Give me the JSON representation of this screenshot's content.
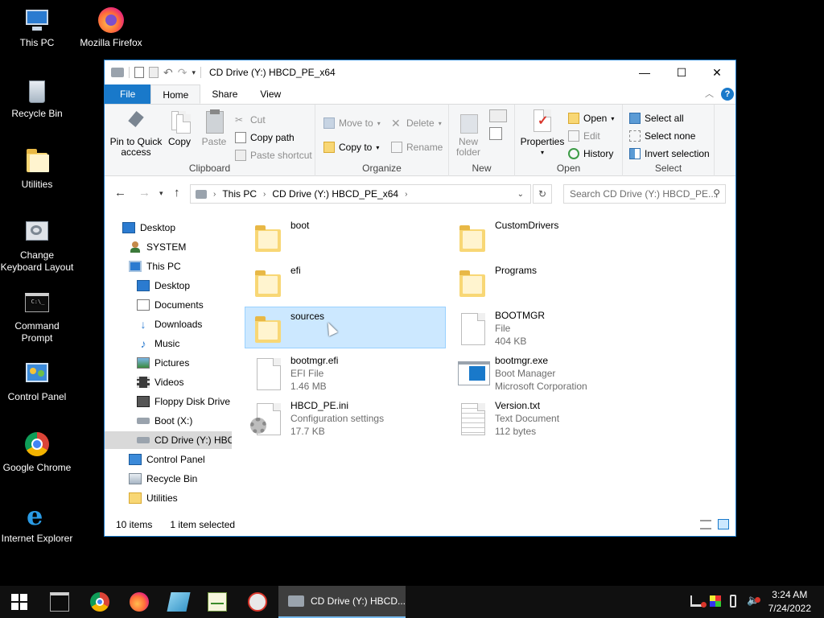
{
  "desktop": {
    "icons": [
      {
        "label": "This PC"
      },
      {
        "label": "Mozilla Firefox"
      },
      {
        "label": "Recycle Bin"
      },
      {
        "label": "Utilities"
      },
      {
        "label": "Change Keyboard Layout"
      },
      {
        "label": "Command Prompt"
      },
      {
        "label": "Control Panel"
      },
      {
        "label": "Google Chrome"
      },
      {
        "label": "Internet Explorer"
      }
    ]
  },
  "window": {
    "title": "CD Drive (Y:) HBCD_PE_x64",
    "controls": {
      "minimize": "—",
      "maximize": "☐",
      "close": "✕"
    }
  },
  "ribbon": {
    "tabs": [
      "File",
      "Home",
      "Share",
      "View"
    ],
    "active_tab": "Home",
    "clipboard": {
      "pin": "Pin to Quick access",
      "copy": "Copy",
      "paste": "Paste",
      "cut": "Cut",
      "copy_path": "Copy path",
      "paste_shortcut": "Paste shortcut",
      "label": "Clipboard"
    },
    "organize": {
      "move_to": "Move to",
      "copy_to": "Copy to",
      "delete": "Delete",
      "rename": "Rename",
      "label": "Organize"
    },
    "new": {
      "new_folder": "New folder",
      "label": "New"
    },
    "open": {
      "properties": "Properties",
      "open": "Open",
      "edit": "Edit",
      "history": "History",
      "label": "Open"
    },
    "select": {
      "select_all": "Select all",
      "select_none": "Select none",
      "invert": "Invert selection",
      "label": "Select"
    }
  },
  "address": {
    "crumbs": [
      "This PC",
      "CD Drive (Y:) HBCD_PE_x64"
    ],
    "search_placeholder": "Search CD Drive (Y:) HBCD_PE..."
  },
  "navpane": {
    "items": [
      {
        "label": "Desktop"
      },
      {
        "label": "SYSTEM"
      },
      {
        "label": "This PC"
      },
      {
        "label": "Desktop"
      },
      {
        "label": "Documents"
      },
      {
        "label": "Downloads"
      },
      {
        "label": "Music"
      },
      {
        "label": "Pictures"
      },
      {
        "label": "Videos"
      },
      {
        "label": "Floppy Disk Drive"
      },
      {
        "label": "Boot (X:)"
      },
      {
        "label": "CD Drive (Y:) HBC"
      },
      {
        "label": "Control Panel"
      },
      {
        "label": "Recycle Bin"
      },
      {
        "label": "Utilities"
      }
    ],
    "selected": "CD Drive (Y:) HBC"
  },
  "files": [
    {
      "name": "boot",
      "line1": "",
      "line2": "",
      "type": "folder"
    },
    {
      "name": "CustomDrivers",
      "line1": "",
      "line2": "",
      "type": "folder"
    },
    {
      "name": "efi",
      "line1": "",
      "line2": "",
      "type": "folder"
    },
    {
      "name": "Programs",
      "line1": "",
      "line2": "",
      "type": "folder"
    },
    {
      "name": "sources",
      "line1": "",
      "line2": "",
      "type": "folder"
    },
    {
      "name": "BOOTMGR",
      "line1": "File",
      "line2": "404 KB",
      "type": "doc"
    },
    {
      "name": "bootmgr.efi",
      "line1": "EFI File",
      "line2": "1.46 MB",
      "type": "doc"
    },
    {
      "name": "bootmgr.exe",
      "line1": "Boot Manager",
      "line2": "Microsoft Corporation",
      "type": "exe"
    },
    {
      "name": "HBCD_PE.ini",
      "line1": "Configuration settings",
      "line2": "17.7 KB",
      "type": "ini"
    },
    {
      "name": "Version.txt",
      "line1": "Text Document",
      "line2": "112 bytes",
      "type": "txt"
    }
  ],
  "status": {
    "count": "10 items",
    "selected": "1 item selected"
  },
  "taskbar": {
    "active_window": "CD Drive (Y:) HBCD...",
    "time": "3:24 AM",
    "date": "7/24/2022"
  },
  "colors": {
    "accent": "#1979ca",
    "selection": "#cce8ff",
    "taskbar": "#101010"
  }
}
